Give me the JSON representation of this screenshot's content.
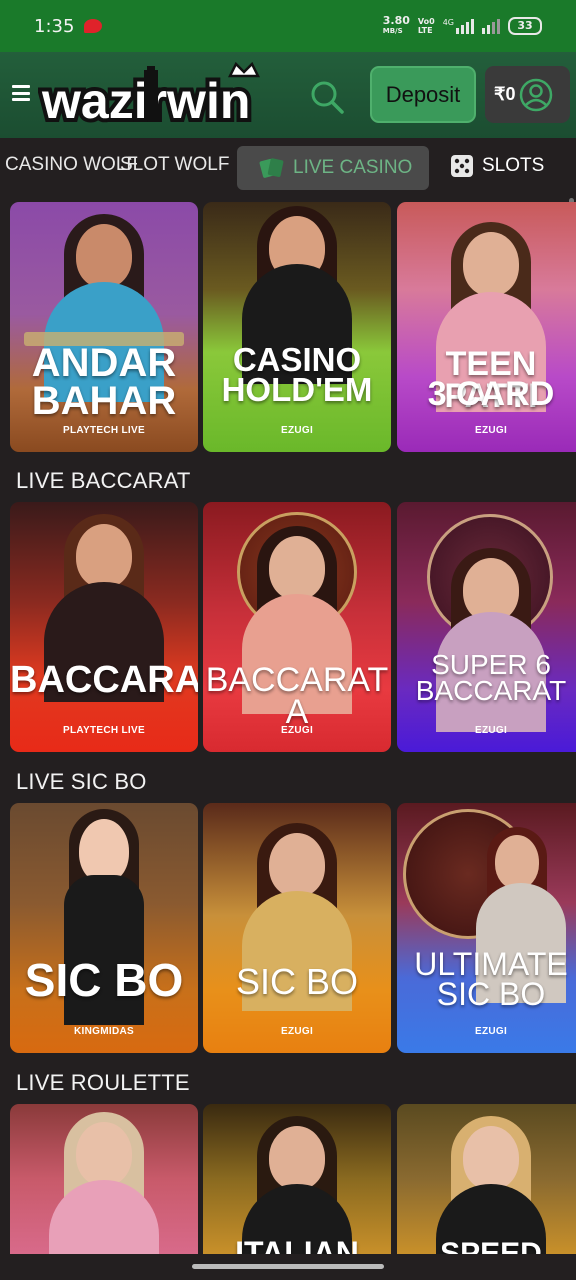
{
  "status_bar": {
    "time": "1:35",
    "speed_value": "3.80",
    "speed_unit": "MB/S",
    "volte_top": "Vo0",
    "volte_bottom": "LTE",
    "net": "4G",
    "battery": "33"
  },
  "header": {
    "logo_text": "wazirwin",
    "deposit_label": "Deposit",
    "balance": "₹0"
  },
  "tabs": {
    "casino_wolf": "CASINO WOLF",
    "slot_wolf": "SLOT WOLF",
    "live_casino": "LIVE CASINO",
    "slots": "SLOTS"
  },
  "sections": {
    "baccarat": "LIVE BACCARAT",
    "sicbo": "LIVE SIC BO",
    "roulette": "LIVE ROULETTE"
  },
  "games": {
    "row1": [
      {
        "line1": "ANDAR",
        "line2": "BAHAR",
        "provider": "PLAYTECH LIVE"
      },
      {
        "line1": "CASINO",
        "line2": "HOLD'EM",
        "provider": "EZUGI"
      },
      {
        "line1": "TEEN PATTI",
        "line2": "3 CARD",
        "provider": "EZUGI"
      }
    ],
    "row2": [
      {
        "line1": "BACCARAT",
        "line2": "",
        "provider": "PLAYTECH LIVE"
      },
      {
        "line1": "BACCARAT A",
        "line2": "",
        "provider": "EZUGI"
      },
      {
        "line1": "SUPER 6",
        "line2": "BACCARAT",
        "provider": "EZUGI"
      }
    ],
    "row3": [
      {
        "line1": "SIC BO",
        "line2": "",
        "provider": "KINGMIDAS"
      },
      {
        "line1": "SIC BO",
        "line2": "",
        "provider": "EZUGI"
      },
      {
        "line1": "ULTIMATE",
        "line2": "SIC BO",
        "provider": "EZUGI"
      }
    ],
    "row4": [
      {
        "line1": "",
        "provider": ""
      },
      {
        "line1": "ITALIAN",
        "provider": ""
      },
      {
        "line1": "SPEED",
        "provider": ""
      }
    ]
  },
  "colors": {
    "status_green": "#1a7a2a",
    "header_green": "#1f5a37",
    "accent_green": "#3a9a5a",
    "background": "#231f20"
  }
}
